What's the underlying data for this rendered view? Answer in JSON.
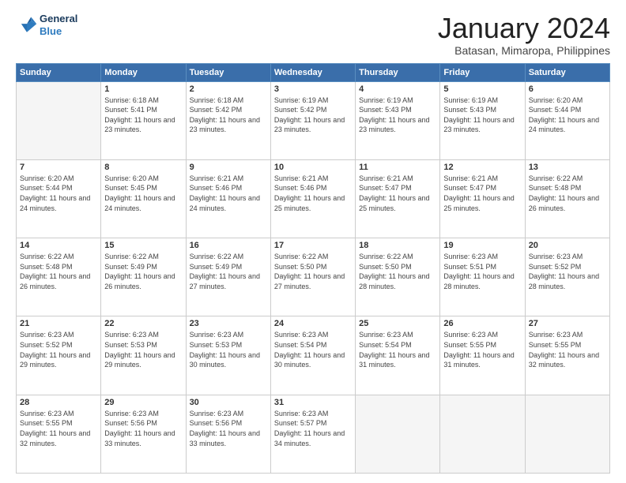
{
  "header": {
    "logo_line1": "General",
    "logo_line2": "Blue",
    "month_title": "January 2024",
    "subtitle": "Batasan, Mimaropa, Philippines"
  },
  "days_of_week": [
    "Sunday",
    "Monday",
    "Tuesday",
    "Wednesday",
    "Thursday",
    "Friday",
    "Saturday"
  ],
  "weeks": [
    [
      {
        "day": "",
        "empty": true
      },
      {
        "day": "1",
        "sunrise": "6:18 AM",
        "sunset": "5:41 PM",
        "daylight": "11 hours and 23 minutes."
      },
      {
        "day": "2",
        "sunrise": "6:18 AM",
        "sunset": "5:42 PM",
        "daylight": "11 hours and 23 minutes."
      },
      {
        "day": "3",
        "sunrise": "6:19 AM",
        "sunset": "5:42 PM",
        "daylight": "11 hours and 23 minutes."
      },
      {
        "day": "4",
        "sunrise": "6:19 AM",
        "sunset": "5:43 PM",
        "daylight": "11 hours and 23 minutes."
      },
      {
        "day": "5",
        "sunrise": "6:19 AM",
        "sunset": "5:43 PM",
        "daylight": "11 hours and 23 minutes."
      },
      {
        "day": "6",
        "sunrise": "6:20 AM",
        "sunset": "5:44 PM",
        "daylight": "11 hours and 24 minutes."
      }
    ],
    [
      {
        "day": "7",
        "sunrise": "6:20 AM",
        "sunset": "5:44 PM",
        "daylight": "11 hours and 24 minutes."
      },
      {
        "day": "8",
        "sunrise": "6:20 AM",
        "sunset": "5:45 PM",
        "daylight": "11 hours and 24 minutes."
      },
      {
        "day": "9",
        "sunrise": "6:21 AM",
        "sunset": "5:46 PM",
        "daylight": "11 hours and 24 minutes."
      },
      {
        "day": "10",
        "sunrise": "6:21 AM",
        "sunset": "5:46 PM",
        "daylight": "11 hours and 25 minutes."
      },
      {
        "day": "11",
        "sunrise": "6:21 AM",
        "sunset": "5:47 PM",
        "daylight": "11 hours and 25 minutes."
      },
      {
        "day": "12",
        "sunrise": "6:21 AM",
        "sunset": "5:47 PM",
        "daylight": "11 hours and 25 minutes."
      },
      {
        "day": "13",
        "sunrise": "6:22 AM",
        "sunset": "5:48 PM",
        "daylight": "11 hours and 26 minutes."
      }
    ],
    [
      {
        "day": "14",
        "sunrise": "6:22 AM",
        "sunset": "5:48 PM",
        "daylight": "11 hours and 26 minutes."
      },
      {
        "day": "15",
        "sunrise": "6:22 AM",
        "sunset": "5:49 PM",
        "daylight": "11 hours and 26 minutes."
      },
      {
        "day": "16",
        "sunrise": "6:22 AM",
        "sunset": "5:49 PM",
        "daylight": "11 hours and 27 minutes."
      },
      {
        "day": "17",
        "sunrise": "6:22 AM",
        "sunset": "5:50 PM",
        "daylight": "11 hours and 27 minutes."
      },
      {
        "day": "18",
        "sunrise": "6:22 AM",
        "sunset": "5:50 PM",
        "daylight": "11 hours and 28 minutes."
      },
      {
        "day": "19",
        "sunrise": "6:23 AM",
        "sunset": "5:51 PM",
        "daylight": "11 hours and 28 minutes."
      },
      {
        "day": "20",
        "sunrise": "6:23 AM",
        "sunset": "5:52 PM",
        "daylight": "11 hours and 28 minutes."
      }
    ],
    [
      {
        "day": "21",
        "sunrise": "6:23 AM",
        "sunset": "5:52 PM",
        "daylight": "11 hours and 29 minutes."
      },
      {
        "day": "22",
        "sunrise": "6:23 AM",
        "sunset": "5:53 PM",
        "daylight": "11 hours and 29 minutes."
      },
      {
        "day": "23",
        "sunrise": "6:23 AM",
        "sunset": "5:53 PM",
        "daylight": "11 hours and 30 minutes."
      },
      {
        "day": "24",
        "sunrise": "6:23 AM",
        "sunset": "5:54 PM",
        "daylight": "11 hours and 30 minutes."
      },
      {
        "day": "25",
        "sunrise": "6:23 AM",
        "sunset": "5:54 PM",
        "daylight": "11 hours and 31 minutes."
      },
      {
        "day": "26",
        "sunrise": "6:23 AM",
        "sunset": "5:55 PM",
        "daylight": "11 hours and 31 minutes."
      },
      {
        "day": "27",
        "sunrise": "6:23 AM",
        "sunset": "5:55 PM",
        "daylight": "11 hours and 32 minutes."
      }
    ],
    [
      {
        "day": "28",
        "sunrise": "6:23 AM",
        "sunset": "5:55 PM",
        "daylight": "11 hours and 32 minutes."
      },
      {
        "day": "29",
        "sunrise": "6:23 AM",
        "sunset": "5:56 PM",
        "daylight": "11 hours and 33 minutes."
      },
      {
        "day": "30",
        "sunrise": "6:23 AM",
        "sunset": "5:56 PM",
        "daylight": "11 hours and 33 minutes."
      },
      {
        "day": "31",
        "sunrise": "6:23 AM",
        "sunset": "5:57 PM",
        "daylight": "11 hours and 34 minutes."
      },
      {
        "day": "",
        "empty": true
      },
      {
        "day": "",
        "empty": true
      },
      {
        "day": "",
        "empty": true
      }
    ]
  ]
}
